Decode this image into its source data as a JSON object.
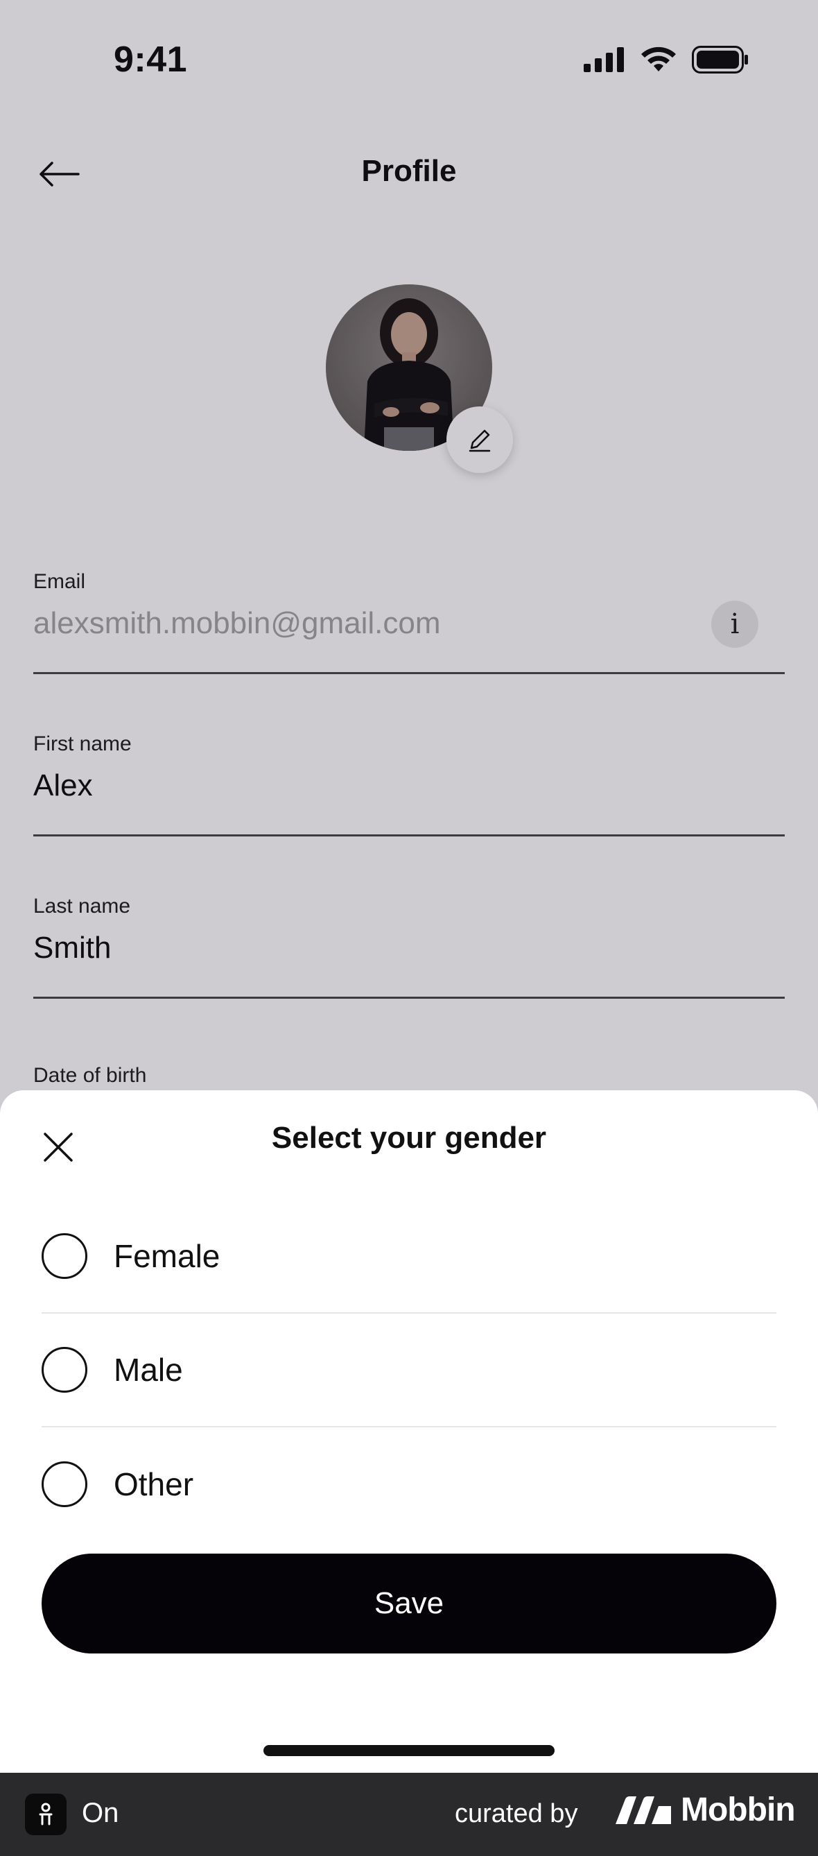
{
  "status_bar": {
    "time": "9:41"
  },
  "header": {
    "title": "Profile",
    "back_icon": "arrow-left-icon"
  },
  "avatar": {
    "edit_icon": "pencil-icon"
  },
  "form": {
    "email": {
      "label": "Email",
      "value": "alexsmith.mobbin@gmail.com",
      "info_glyph": "i"
    },
    "first_name": {
      "label": "First name",
      "value": "Alex"
    },
    "last_name": {
      "label": "Last name",
      "value": "Smith"
    },
    "date_of_birth": {
      "label": "Date of birth"
    }
  },
  "gender_sheet": {
    "title": "Select your gender",
    "close_icon": "close-icon",
    "options": [
      {
        "label": "Female",
        "selected": false
      },
      {
        "label": "Male",
        "selected": false
      },
      {
        "label": "Other",
        "selected": false
      }
    ],
    "save_label": "Save"
  },
  "footer": {
    "status": "On",
    "curated_by": "curated by",
    "brand": "Mobbin"
  },
  "colors": {
    "primary": "#050307",
    "background": "#ffffff",
    "footer_bg": "#2a2a2c",
    "scrim": "rgba(8,0,20,0.2)"
  }
}
